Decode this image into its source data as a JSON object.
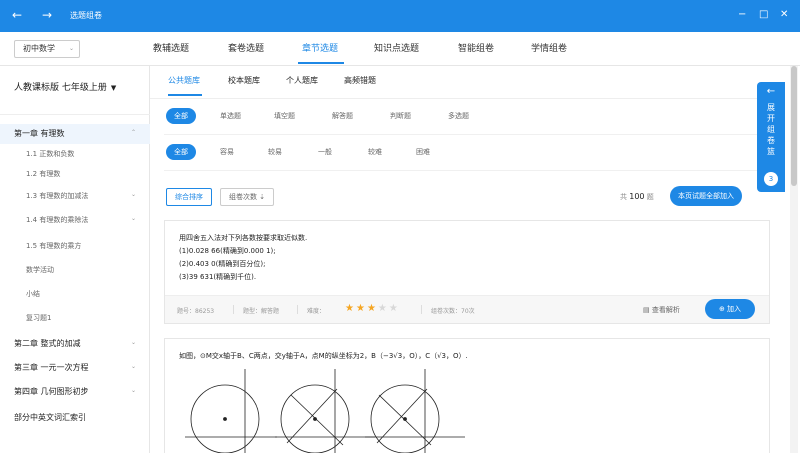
{
  "window": {
    "title": "选题组卷",
    "back": "←",
    "forward": "→",
    "minimize": "−",
    "maximize": "□",
    "close": "✕"
  },
  "topnav": {
    "grade": "初中数学",
    "tabs": [
      "教辅选题",
      "套卷选题",
      "章节选题",
      "知识点选题",
      "智能组卷",
      "学情组卷"
    ],
    "active_tab": "章节选题"
  },
  "sidebar": {
    "textbook": "人教课标版 七年级上册",
    "tree": [
      {
        "label": "第一章 有理数",
        "level": 0,
        "expander": "⌃",
        "active": true
      },
      {
        "label": "1.1 正数和负数",
        "level": 1
      },
      {
        "label": "1.2 有理数",
        "level": 1
      },
      {
        "label": "1.3 有理数的加减法",
        "level": 1,
        "expander": "⌄"
      },
      {
        "label": "1.4 有理数的乘除法",
        "level": 1,
        "expander": "⌄"
      },
      {
        "label": "1.5 有理数的乘方",
        "level": 1
      },
      {
        "label": "数学活动",
        "level": 1
      },
      {
        "label": "小结",
        "level": 1
      },
      {
        "label": "复习题1",
        "level": 1
      },
      {
        "label": "第二章 整式的加减",
        "level": 0,
        "expander": "⌄"
      },
      {
        "label": "第三章 一元一次方程",
        "level": 0,
        "expander": "⌄"
      },
      {
        "label": "第四章 几何图形初步",
        "level": 0,
        "expander": "⌄"
      },
      {
        "label": "部分中英文词汇索引",
        "level": 0
      }
    ]
  },
  "main": {
    "subtabs": [
      "公共题库",
      "校本题库",
      "个人题库",
      "高频错题"
    ],
    "type_filters": [
      "全部",
      "单选题",
      "填空题",
      "解答题",
      "判断题",
      "多选题"
    ],
    "difficulty_filters": [
      "全部",
      "容易",
      "较易",
      "一般",
      "较难",
      "困难"
    ],
    "sort": {
      "composite": "综合排序",
      "usage": "组卷次数 ⇣"
    },
    "total_prefix": "共",
    "total_count": "100",
    "total_suffix": "题",
    "add_all": "本页试题全部加入"
  },
  "question1": {
    "lines": [
      "用四舍五入法对下列各数按要求取近似数.",
      "(1)0.028 66(精确到0.000 1);",
      "(2)0.403 0(精确到百分位);",
      "(3)39 631(精确到千位)."
    ],
    "meta": {
      "id": "题号：86253",
      "type": "题型：解答题",
      "difficulty_label": "难度：",
      "usage": "组卷次数：70次"
    },
    "difficulty_stars": 3,
    "difficulty_max": 5,
    "analysis": "查看解析",
    "add": "加入"
  },
  "question2": {
    "text": "如图，⊙M交x轴于B、C两点，交y轴于A，点M的纵坐标为2，B（−3√3，O），C（√3，O）."
  },
  "side_panel": {
    "arrow": "←",
    "text": "展开组卷篮",
    "count": "3"
  }
}
